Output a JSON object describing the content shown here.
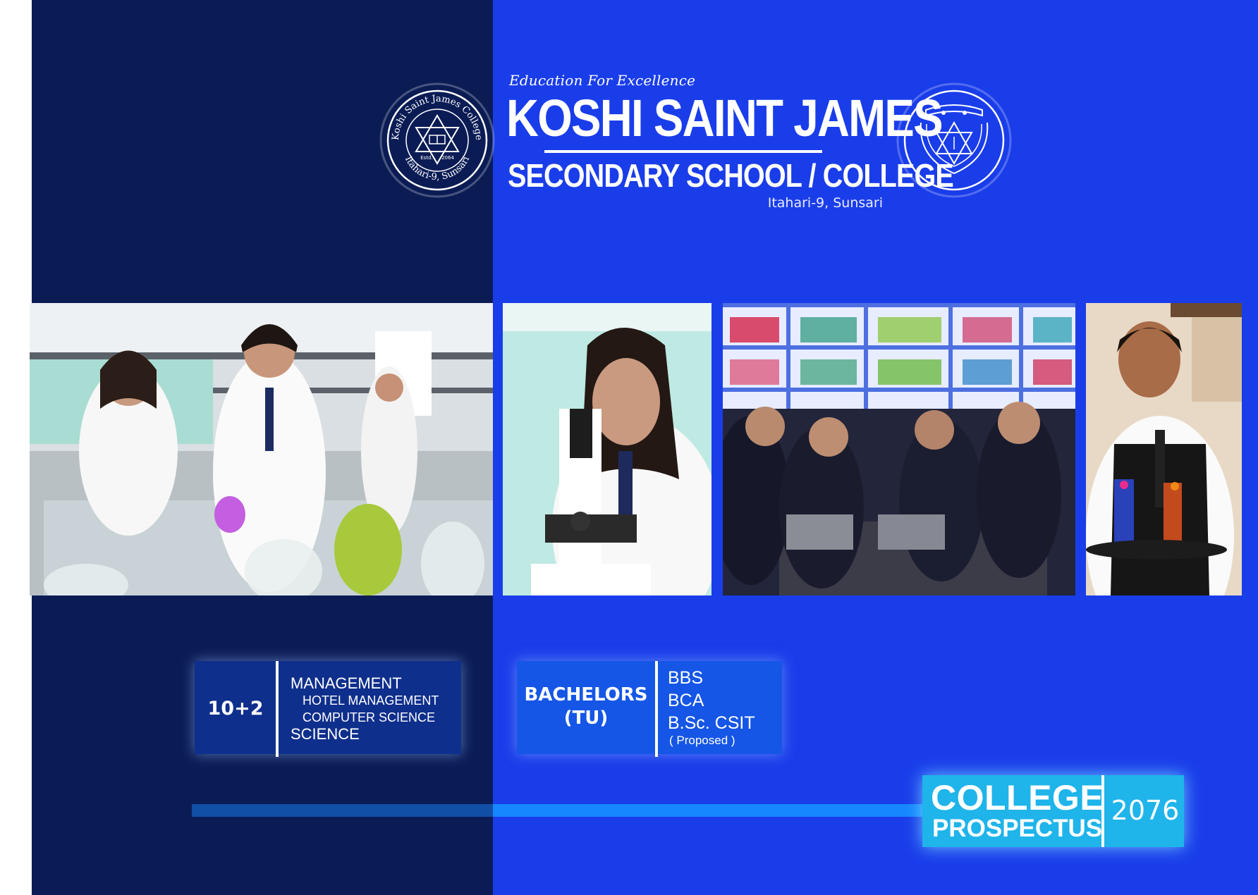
{
  "header": {
    "tagline": "Education For Excellence",
    "name": "KOSHI SAINT JAMES",
    "subtitle": "SECONDARY SCHOOL / COLLEGE",
    "location": "Itahari-9, Sunsari"
  },
  "emblems": {
    "left": {
      "icon": "college-seal-icon",
      "ring_top": "Koshi Saint James College",
      "ring_bottom": "Itahari-9, Sunsari",
      "estd": "Estd.",
      "year": "2064"
    },
    "right": {
      "icon": "school-crest-icon"
    }
  },
  "photos": [
    {
      "icon": "chemistry-lab-photo"
    },
    {
      "icon": "microscope-photo"
    },
    {
      "icon": "computer-library-photo"
    },
    {
      "icon": "hotel-service-photo"
    }
  ],
  "programs": {
    "plus_two": {
      "level": "10+2",
      "items": [
        {
          "label": "MANAGEMENT",
          "sub": false
        },
        {
          "label": "HOTEL MANAGEMENT",
          "sub": true
        },
        {
          "label": "COMPUTER SCIENCE",
          "sub": true
        },
        {
          "label": "SCIENCE",
          "sub": false
        }
      ]
    },
    "bachelors": {
      "level_line1": "BACHELORS",
      "level_line2": "(TU)",
      "items": [
        "BBS",
        "BCA",
        "B.Sc. CSIT"
      ],
      "note": "( Proposed )"
    }
  },
  "prospectus": {
    "line1": "COLLEGE",
    "line2": "PROSPECTUS",
    "year": "2076"
  },
  "colors": {
    "dark_panel": "#0b1c55",
    "bright_panel": "#1a3dea",
    "prospectus_badge": "#1fb4ea"
  }
}
